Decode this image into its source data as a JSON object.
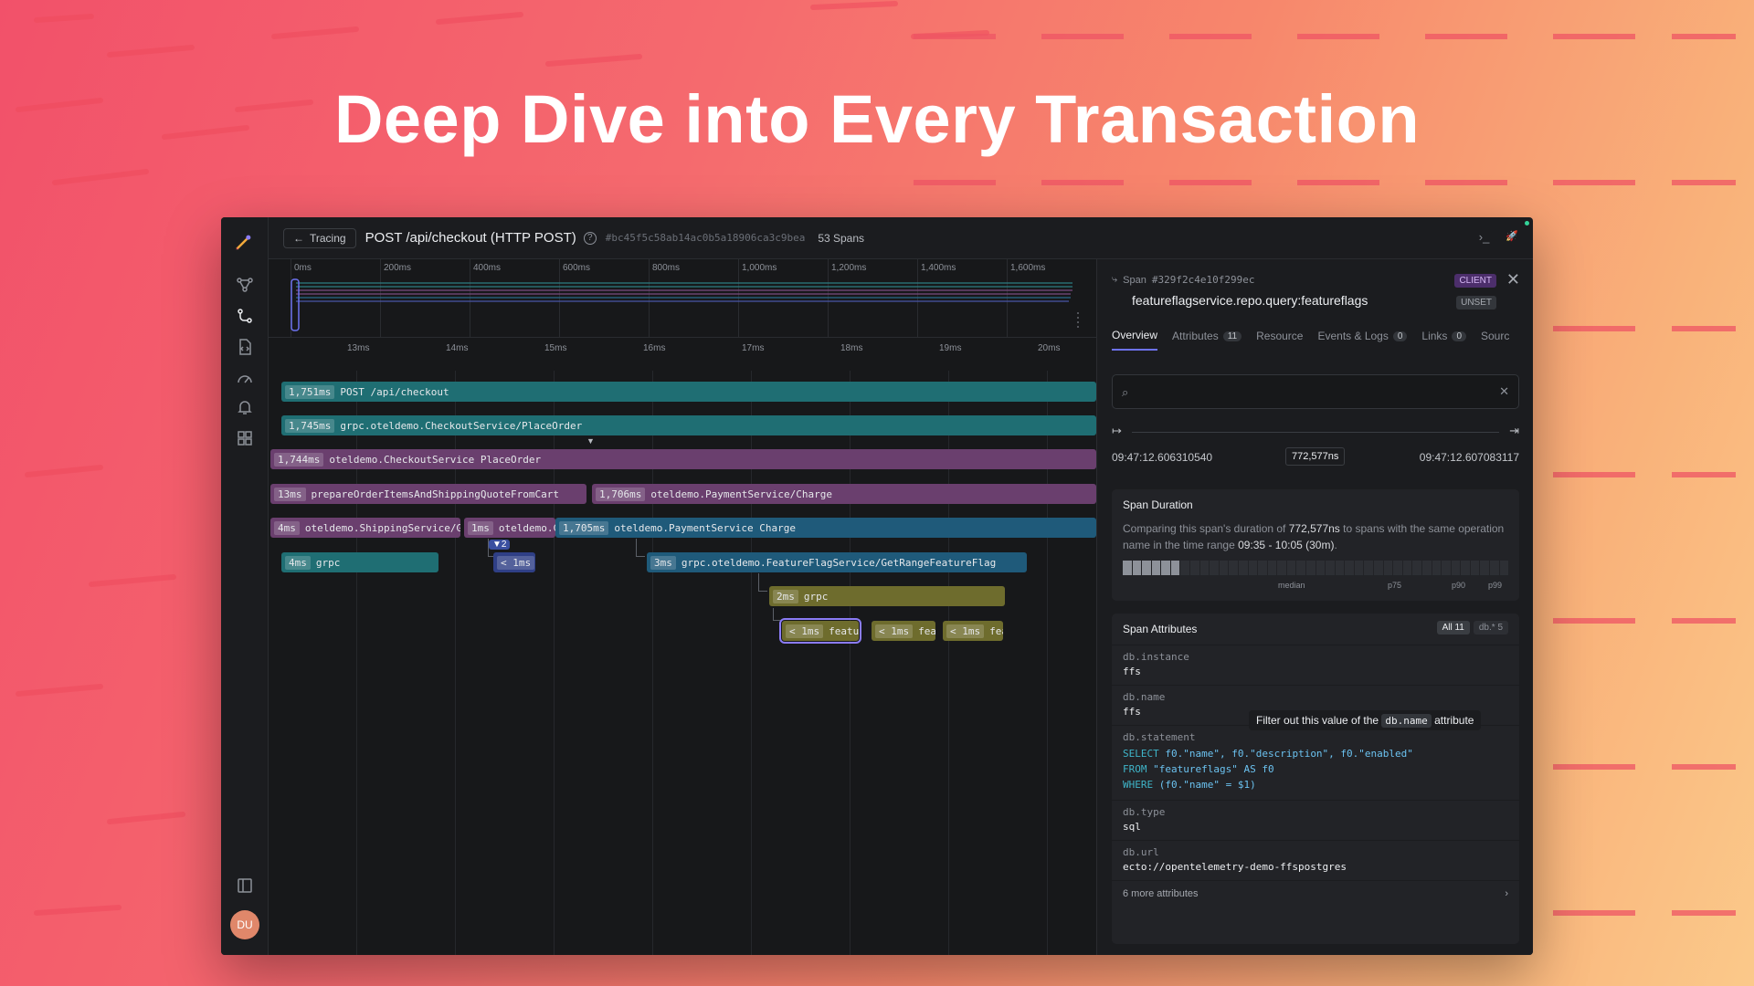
{
  "headline": "Deep Dive into Every Transaction",
  "colors": {
    "accent": "#6d72f0",
    "teal": "#1f6e73",
    "purple": "#6a3f6e",
    "blue": "#1f5a7a",
    "olive": "#6e6c2d",
    "navy": "#2f3f86"
  },
  "sidebar": {
    "icons": [
      "service-map-icon",
      "tracing-icon",
      "logs-icon",
      "metrics-gauge-icon",
      "alerts-bell-icon",
      "dashboards-grid-icon",
      "panel-toggle-icon"
    ],
    "avatar": "DU"
  },
  "topbar": {
    "back_label": "Tracing",
    "title": "POST /api/checkout (HTTP POST)",
    "help": "?",
    "trace_id": "#bc45f5c58ab14ac0b5a18906ca3c9bea",
    "span_count": "53 Spans",
    "terminal": "›_",
    "rocket": "🚀"
  },
  "minimap": {
    "ticks": [
      "0ms",
      "200ms",
      "400ms",
      "600ms",
      "800ms",
      "1,000ms",
      "1,200ms",
      "1,400ms",
      "1,600ms"
    ]
  },
  "zoom_axis": {
    "ticks": [
      "13ms",
      "14ms",
      "15ms",
      "16ms",
      "17ms",
      "18ms",
      "19ms",
      "20ms"
    ]
  },
  "spans": [
    {
      "duration": "1,751ms",
      "name": "POST /api/checkout"
    },
    {
      "duration": "1,745ms",
      "name": "grpc.oteldemo.CheckoutService/PlaceOrder"
    },
    {
      "duration": "1,744ms",
      "name": "oteldemo.CheckoutService PlaceOrder"
    },
    {
      "duration": "13ms",
      "name": "prepareOrderItemsAndShippingQuoteFromCart"
    },
    {
      "duration": "1,706ms",
      "name": "oteldemo.PaymentService/Charge"
    },
    {
      "duration": "4ms",
      "name": "oteldemo.ShippingService/GetQuote"
    },
    {
      "duration": "1ms",
      "name": "oteldemo.CurrencyService"
    },
    {
      "duration": "1,705ms",
      "name": "oteldemo.PaymentService Charge"
    },
    {
      "duration": "4ms",
      "name": "grpc"
    },
    {
      "duration": "< 1ms",
      "name": ""
    },
    {
      "duration": "3ms",
      "name": "grpc.oteldemo.FeatureFlagService/GetRangeFeatureFlag"
    },
    {
      "duration": "2ms",
      "name": "grpc"
    },
    {
      "duration": "< 1ms",
      "name": "featureflagservice.repo.query"
    },
    {
      "duration": "< 1ms",
      "name": "featureflagservice"
    },
    {
      "duration": "< 1ms",
      "name": "featureflagservice"
    }
  ],
  "collapsed_badge": "▼2",
  "detail": {
    "span_label": "Span",
    "span_id": "#329f2c4e10f299ec",
    "span_name": "featureflagservice.repo.query:featureflags",
    "kind_badge": "CLIENT",
    "status_badge": "UNSET",
    "close": "✕",
    "tabs": [
      {
        "label": "Overview",
        "count": ""
      },
      {
        "label": "Attributes",
        "count": "11"
      },
      {
        "label": "Resource",
        "count": ""
      },
      {
        "label": "Events & Logs",
        "count": "0"
      },
      {
        "label": "Links",
        "count": "0"
      },
      {
        "label": "Sourc",
        "count": ""
      }
    ],
    "search_placeholder": "",
    "start_time": "09:47:12.606310540",
    "end_time": "09:47:12.607083117",
    "duration": "772,577ns",
    "span_duration": {
      "title": "Span Duration",
      "text_pre": "Comparing this span's duration of ",
      "value": "772,577ns",
      "text_mid": " to spans with the same operation name in the time range ",
      "range": "09:35 - 10:05 (30m)",
      "text_end": ".",
      "labels": [
        "median",
        "p75",
        "p90",
        "p99"
      ]
    },
    "attributes": {
      "title": "Span Attributes",
      "filter_all": "All",
      "filter_all_count": "11",
      "filter_db": "db.*",
      "filter_db_count": "5",
      "items": [
        {
          "key": "db.instance",
          "value": "ffs"
        },
        {
          "key": "db.name",
          "value": "ffs"
        },
        {
          "key": "db.statement",
          "value": ""
        },
        {
          "key": "db.type",
          "value": "sql"
        },
        {
          "key": "db.url",
          "value": "ecto://opentelemetry-demo-ffspostgres"
        }
      ],
      "sql": {
        "line1_kw": "SELECT",
        "line1_rest": " f0.\"name\", f0.\"description\", f0.\"enabled\"",
        "line2_kw": "FROM",
        "line2_rest": " \"featureflags\" AS f0",
        "line3_kw": "WHERE",
        "line3_rest": " (f0.\"name\" = $1)"
      },
      "more": "6 more attributes"
    },
    "tooltip": {
      "pre": "Filter out this value of the ",
      "code": "db.name",
      "post": " attribute"
    }
  }
}
